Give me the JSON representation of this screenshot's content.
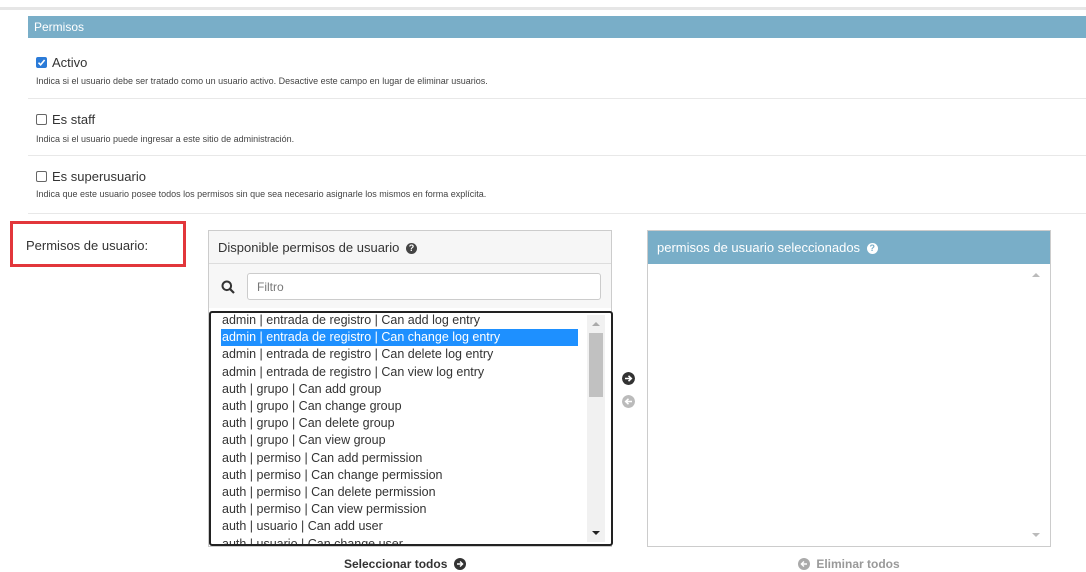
{
  "section": {
    "title": "Permisos"
  },
  "fields": [
    {
      "label": "Activo",
      "checked": true,
      "help": "Indica si el usuario debe ser tratado como un usuario activo. Desactive este campo en lugar de eliminar usuarios."
    },
    {
      "label": "Es staff",
      "checked": false,
      "help": "Indica si el usuario puede ingresar a este sitio de administración."
    },
    {
      "label": "Es superusuario",
      "checked": false,
      "help": "Indica que este usuario posee todos los permisos sin que sea necesario asignarle los mismos en forma explícita."
    }
  ],
  "permissions": {
    "label": "Permisos de usuario:",
    "available_title": "Disponible permisos de usuario",
    "filter_placeholder": "Filtro",
    "chosen_title": "permisos de usuario seleccionados",
    "choose_all": "Seleccionar todos",
    "remove_all": "Eliminar todos",
    "selected_index": 1,
    "items": [
      "admin | entrada de registro | Can add log entry",
      "admin | entrada de registro | Can change log entry",
      "admin | entrada de registro | Can delete log entry",
      "admin | entrada de registro | Can view log entry",
      "auth | grupo | Can add group",
      "auth | grupo | Can change group",
      "auth | grupo | Can delete group",
      "auth | grupo | Can view group",
      "auth | permiso | Can add permission",
      "auth | permiso | Can change permission",
      "auth | permiso | Can delete permission",
      "auth | permiso | Can view permission",
      "auth | usuario | Can add user",
      "auth | usuario | Can change user"
    ]
  },
  "colors": {
    "header": "#79aec8",
    "selection": "#1e90ff",
    "highlight_border": "#e2363b"
  },
  "icons": [
    "checkbox-checked",
    "checkbox-empty",
    "help-icon",
    "search-icon",
    "arrow-right-circle-icon",
    "arrow-left-circle-icon"
  ]
}
